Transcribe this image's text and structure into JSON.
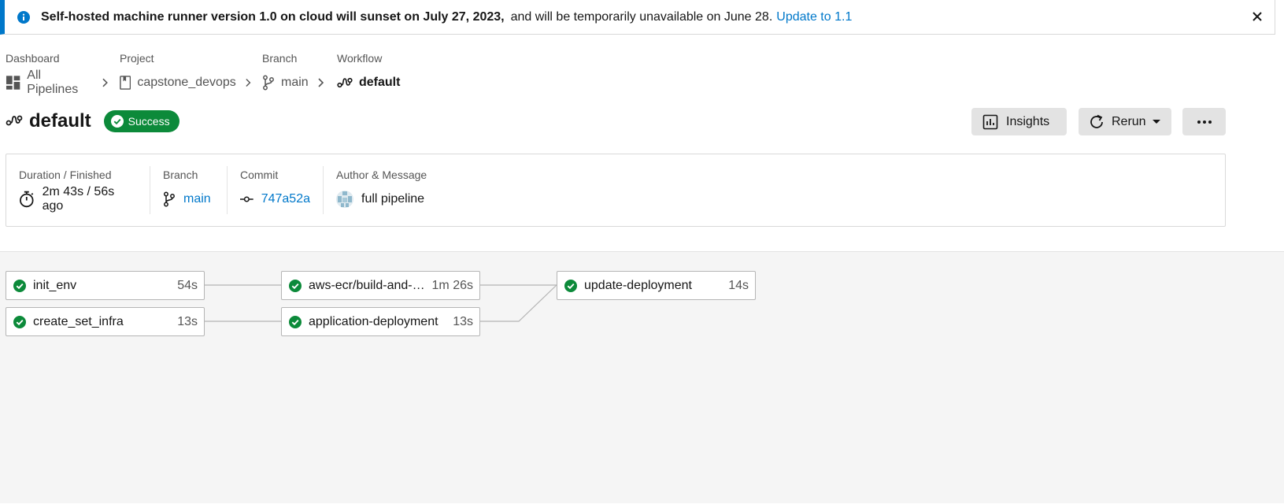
{
  "banner": {
    "bold_text": "Self-hosted machine runner version 1.0 on cloud will sunset on July 27, 2023,",
    "rest_text": "and will be temporarily unavailable on June 28.",
    "link_text": "Update to 1.1",
    "icons": {
      "info": "info-icon",
      "close": "close-icon"
    }
  },
  "breadcrumb": [
    {
      "label": "Dashboard",
      "value": "All Pipelines",
      "icon": "dashboard-icon"
    },
    {
      "label": "Project",
      "value": "capstone_devops",
      "icon": "project-icon"
    },
    {
      "label": "Branch",
      "value": "main",
      "icon": "branch-icon"
    },
    {
      "label": "Workflow",
      "value": "default",
      "icon": "workflow-icon"
    }
  ],
  "header": {
    "title": "default",
    "status": "Success",
    "insights_label": "Insights",
    "rerun_label": "Rerun"
  },
  "summary": {
    "duration_label": "Duration / Finished",
    "duration_value": "2m 43s / 56s ago",
    "branch_label": "Branch",
    "branch_value": "main",
    "commit_label": "Commit",
    "commit_value": "747a52a",
    "author_label": "Author & Message",
    "message_value": "full pipeline"
  },
  "jobs": [
    {
      "name": "init_env",
      "duration": "54s",
      "status": "success"
    },
    {
      "name": "create_set_infra",
      "duration": "13s",
      "status": "success"
    },
    {
      "name": "aws-ecr/build-and-pu…",
      "duration": "1m 26s",
      "status": "success"
    },
    {
      "name": "application-deployment",
      "duration": "13s",
      "status": "success"
    },
    {
      "name": "update-deployment",
      "duration": "14s",
      "status": "success"
    }
  ],
  "colors": {
    "accent": "#0078ca",
    "success": "#0c8a3a",
    "button_bg": "#e3e3e3",
    "canvas_bg": "#f5f5f5"
  }
}
